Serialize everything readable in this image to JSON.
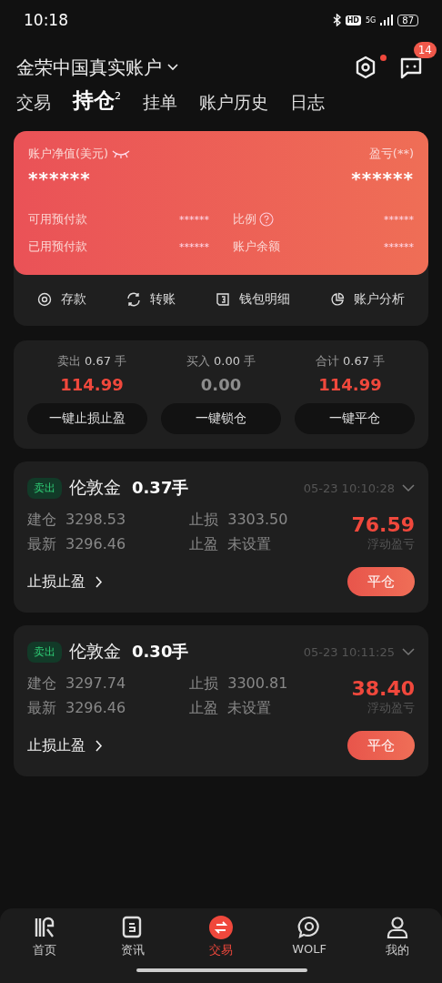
{
  "status_bar": {
    "time": "10:18",
    "hd": "HD",
    "network": "5G",
    "battery": "87"
  },
  "header": {
    "account": "金荣中国真实账户",
    "settings_dot": true,
    "message_count": "14"
  },
  "tabs": [
    {
      "label": "交易",
      "selected": false
    },
    {
      "label": "持仓",
      "badge": "2",
      "selected": true
    },
    {
      "label": "挂单",
      "selected": false
    },
    {
      "label": "账户历史",
      "selected": false
    },
    {
      "label": "日志",
      "selected": false
    }
  ],
  "account_card": {
    "equity_label": "账户净值(美元)",
    "equity": "******",
    "pnl_label": "盈亏(**)",
    "pnl": "******",
    "rows": [
      {
        "label": "可用预付款",
        "value": "******"
      },
      {
        "label": "比例",
        "value": "******",
        "help": true
      },
      {
        "label": "已用预付款",
        "value": "******"
      },
      {
        "label": "账户余额",
        "value": "******"
      }
    ]
  },
  "actions": [
    {
      "label": "存款",
      "kind": "deposit"
    },
    {
      "label": "转账",
      "kind": "transfer"
    },
    {
      "label": "钱包明细",
      "kind": "wallet"
    },
    {
      "label": "账户分析",
      "kind": "analysis"
    }
  ],
  "summary": [
    {
      "label": "卖出",
      "lots": "0.67",
      "unit": "手",
      "value": "114.99",
      "color": "#f0483c"
    },
    {
      "label": "买入",
      "lots": "0.00",
      "unit": "手",
      "value": "0.00",
      "color": "#8c8c8c"
    },
    {
      "label": "合计",
      "lots": "0.67",
      "unit": "手",
      "value": "114.99",
      "color": "#f0483c"
    }
  ],
  "summary_buttons": [
    "一键止损止盈",
    "一键锁仓",
    "一键平仓"
  ],
  "positions": [
    {
      "side": "卖出",
      "symbol": "伦敦金",
      "lots": "0.37手",
      "time": "05-23 10:10:28",
      "fields": [
        {
          "label": "建仓",
          "value": "3298.53"
        },
        {
          "label": "止损",
          "value": "3303.50"
        },
        {
          "label": "最新",
          "value": "3296.46"
        },
        {
          "label": "止盈",
          "value": "未设置"
        }
      ],
      "pnl": "76.59",
      "pnl_label": "浮动盈亏",
      "sltp_link": "止损止盈",
      "close_button": "平仓"
    },
    {
      "side": "卖出",
      "symbol": "伦敦金",
      "lots": "0.30手",
      "time": "05-23 10:11:25",
      "fields": [
        {
          "label": "建仓",
          "value": "3297.74"
        },
        {
          "label": "止损",
          "value": "3300.81"
        },
        {
          "label": "最新",
          "value": "3296.46"
        },
        {
          "label": "止盈",
          "value": "未设置"
        }
      ],
      "pnl": "38.40",
      "pnl_label": "浮动盈亏",
      "sltp_link": "止损止盈",
      "close_button": "平仓"
    }
  ],
  "nav": [
    {
      "label": "首页",
      "kind": "home",
      "selected": false
    },
    {
      "label": "资讯",
      "kind": "news",
      "selected": false
    },
    {
      "label": "交易",
      "kind": "trade",
      "selected": true
    },
    {
      "label": "WOLF",
      "kind": "chat",
      "selected": false
    },
    {
      "label": "我的",
      "kind": "profile",
      "selected": false
    }
  ]
}
